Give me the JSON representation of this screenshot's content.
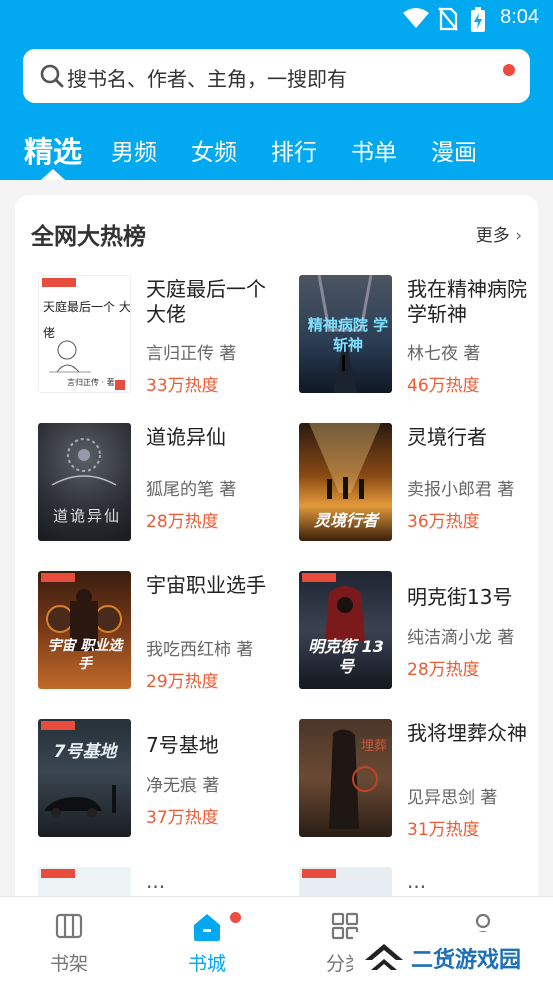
{
  "status": {
    "time": "8:04"
  },
  "search": {
    "placeholder": "搜书名、作者、主角，一搜即有"
  },
  "tabs": [
    {
      "label": "精选"
    },
    {
      "label": "男频"
    },
    {
      "label": "女频"
    },
    {
      "label": "排行"
    },
    {
      "label": "书单"
    },
    {
      "label": "漫画"
    }
  ],
  "section": {
    "title": "全网大热榜",
    "more": "更多"
  },
  "books": [
    {
      "title": "天庭最后一个大佬",
      "author": "言归正传 著",
      "heat": "33万热度",
      "cover_text": "天庭最后一个 大佬",
      "cover_author": "言归正传 · 著"
    },
    {
      "title": "我在精神病院学斩神",
      "author": "林七夜 著",
      "heat": "46万热度",
      "cover_text": "精神病院 学斩神"
    },
    {
      "title": "道诡异仙",
      "author": "狐尾的笔 著",
      "heat": "28万热度",
      "cover_text": "道诡异仙"
    },
    {
      "title": "灵境行者",
      "author": "卖报小郎君 著",
      "heat": "36万热度",
      "cover_text": "灵境行者"
    },
    {
      "title": "宇宙职业选手",
      "author": "我吃西红柿 著",
      "heat": "29万热度",
      "cover_text": "宇宙 职业选手"
    },
    {
      "title": "明克街13号",
      "author": "纯洁滴小龙 著",
      "heat": "28万热度",
      "cover_text": "明克街 13号"
    },
    {
      "title": "7号基地",
      "author": "净无痕 著",
      "heat": "37万热度",
      "cover_text": "7号基地"
    },
    {
      "title": "我将埋葬众神",
      "author": "见异思剑 著",
      "heat": "31万热度",
      "cover_text": "埋葬"
    },
    {
      "title": "...",
      "author": "",
      "heat": ""
    },
    {
      "title": "...",
      "author": "",
      "heat": ""
    }
  ],
  "bottom_nav": [
    {
      "label": "书架",
      "icon": "bookshelf-icon"
    },
    {
      "label": "书城",
      "icon": "bookstore-icon"
    },
    {
      "label": "分类",
      "icon": "category-icon"
    },
    {
      "label": "我的",
      "icon": "profile-icon"
    }
  ],
  "watermark": {
    "text": "二货游戏园"
  },
  "colors": {
    "brand": "#02a9f1",
    "heat": "#ef5a34",
    "badge": "#ef4c43"
  }
}
